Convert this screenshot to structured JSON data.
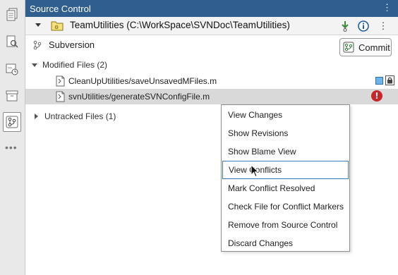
{
  "panel": {
    "title": "Source Control"
  },
  "repository": {
    "label": "TeamUtilities (C:\\WorkSpace\\SVNDoc\\TeamUtilities)"
  },
  "vcs": {
    "label": "Subversion",
    "commit_label": "Commit"
  },
  "groups": {
    "modified": {
      "label": "Modified Files (2)",
      "files": [
        {
          "name": "CleanUpUtilities/saveUnsavedMFiles.m"
        },
        {
          "name": "svnUtilities/generateSVNConfigFile.m",
          "status_symbol": "!"
        }
      ]
    },
    "untracked": {
      "label": "Untracked Files (1)"
    }
  },
  "context_menu": {
    "items": [
      "View Changes",
      "Show Revisions",
      "Show Blame View",
      "View Conflicts",
      "Mark Conflict Resolved",
      "Check File for Conflict Markers",
      "Remove from Source Control",
      "Discard Changes"
    ]
  },
  "colors": {
    "title_bar": "#2f5e8f",
    "conflict": "#c9262b",
    "modified": "#6fb4e8"
  }
}
